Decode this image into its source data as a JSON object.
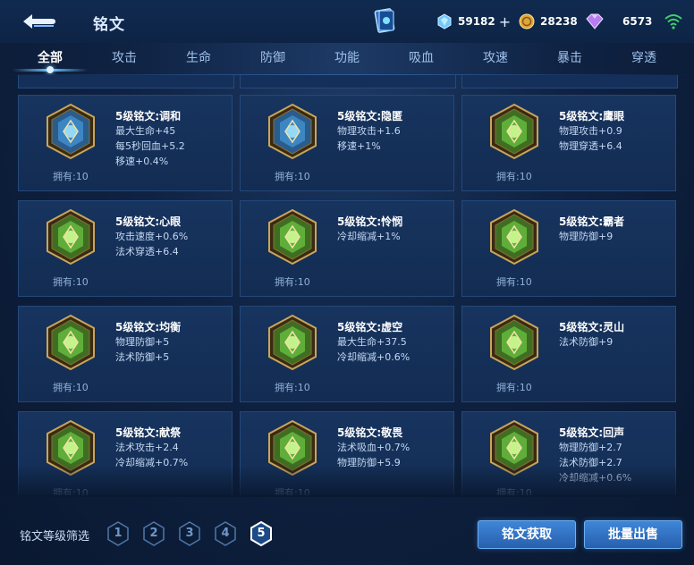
{
  "header": {
    "title": "铭文",
    "currencies": [
      {
        "name": "diamond",
        "icon": "diamond-icon",
        "value": "59182",
        "has_plus": true
      },
      {
        "name": "gold",
        "icon": "gold-coin-icon",
        "value": "28238",
        "has_plus": false
      },
      {
        "name": "gem",
        "icon": "purple-gem-icon",
        "value": "6573",
        "has_plus": false
      }
    ],
    "plus_label": "+"
  },
  "tabs": [
    "全部",
    "攻击",
    "生命",
    "防御",
    "功能",
    "吸血",
    "攻速",
    "暴击",
    "穿透"
  ],
  "active_tab": 0,
  "cards": [
    {
      "name": "5级铭文:调和",
      "attrs": [
        "最大生命+45",
        "每5秒回血+5.2",
        "移速+0.4%"
      ],
      "owned": "拥有:10",
      "color": "blue",
      "icon": "leaf-rune-icon"
    },
    {
      "name": "5级铭文:隐匿",
      "attrs": [
        "物理攻击+1.6",
        "移速+1%"
      ],
      "owned": "拥有:10",
      "color": "blue",
      "icon": "flame-rune-icon"
    },
    {
      "name": "5级铭文:鹰眼",
      "attrs": [
        "物理攻击+0.9",
        "物理穿透+6.4"
      ],
      "owned": "拥有:10",
      "color": "green",
      "icon": "eagle-rune-icon"
    },
    {
      "name": "5级铭文:心眼",
      "attrs": [
        "攻击速度+0.6%",
        "法术穿透+6.4"
      ],
      "owned": "拥有:10",
      "color": "green",
      "icon": "gate-rune-icon"
    },
    {
      "name": "5级铭文:怜悯",
      "attrs": [
        "冷却缩减+1%"
      ],
      "owned": "拥有:10",
      "color": "green",
      "icon": "star-rune-icon"
    },
    {
      "name": "5级铭文:霸者",
      "attrs": [
        "物理防御+9"
      ],
      "owned": "拥有:10",
      "color": "green",
      "icon": "arch-rune-icon"
    },
    {
      "name": "5级铭文:均衡",
      "attrs": [
        "物理防御+5",
        "法术防御+5"
      ],
      "owned": "拥有:10",
      "color": "green",
      "icon": "balance-rune-icon"
    },
    {
      "name": "5级铭文:虚空",
      "attrs": [
        "最大生命+37.5",
        "冷却缩减+0.6%"
      ],
      "owned": "拥有:10",
      "color": "green",
      "icon": "void-rune-icon"
    },
    {
      "name": "5级铭文:灵山",
      "attrs": [
        "法术防御+9"
      ],
      "owned": "拥有:10",
      "color": "green",
      "icon": "mountain-rune-icon"
    },
    {
      "name": "5级铭文:献祭",
      "attrs": [
        "法术攻击+2.4",
        "冷却缩减+0.7%"
      ],
      "owned": "拥有:10",
      "color": "green",
      "icon": "sacrifice-rune-icon"
    },
    {
      "name": "5级铭文:敬畏",
      "attrs": [
        "法术吸血+0.7%",
        "物理防御+5.9"
      ],
      "owned": "拥有:10",
      "color": "green",
      "icon": "awe-rune-icon"
    },
    {
      "name": "5级铭文:回声",
      "attrs": [
        "物理防御+2.7",
        "法术防御+2.7",
        "冷却缩减+0.6%"
      ],
      "owned": "拥有:10",
      "color": "green",
      "icon": "echo-rune-icon"
    }
  ],
  "filter": {
    "label": "铭文等级筛选",
    "levels": [
      "1",
      "2",
      "3",
      "4",
      "5"
    ],
    "selected": "5"
  },
  "buttons": {
    "obtain": "铭文获取",
    "bulk_sell": "批量出售"
  },
  "colors": {
    "accent": "#6fc4ff",
    "blue_rune": "#5fb4e8",
    "green_rune": "#5fae3a",
    "gold_frame": "#c9a55a"
  }
}
